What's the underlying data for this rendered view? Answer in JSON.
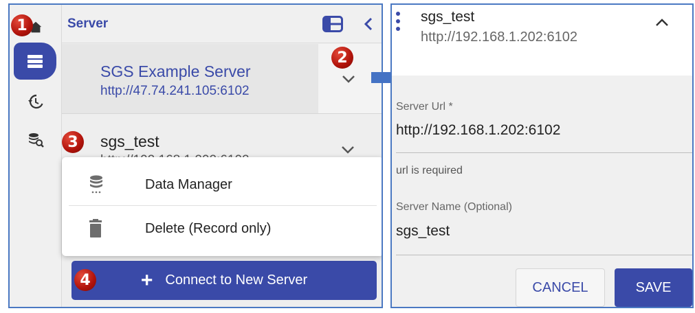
{
  "left": {
    "header_title": "Server",
    "servers": [
      {
        "name": "SGS Example Server",
        "url": "http://47.74.241.105:6102"
      },
      {
        "name": "sgs_test",
        "url": "http://192.168.1.202:6102"
      }
    ],
    "context_menu": [
      {
        "label": "Data Manager",
        "icon": "database-icon"
      },
      {
        "label": "Delete (Record only)",
        "icon": "trash-icon"
      }
    ],
    "connect_button": "Connect to New Server"
  },
  "right": {
    "name": "sgs_test",
    "url": "http://192.168.1.202:6102",
    "fields": [
      {
        "label": "Server Url *",
        "value": "http://192.168.1.202:6102",
        "helper": "url is required"
      },
      {
        "label": "Server Name (Optional)",
        "value": "sgs_test"
      }
    ],
    "cancel_label": "CANCEL",
    "save_label": "SAVE"
  },
  "badges": [
    "1",
    "2",
    "3",
    "4"
  ],
  "colors": {
    "accent": "#3a4aa8",
    "badge": "#b0120a",
    "frame": "#4a78c2"
  }
}
